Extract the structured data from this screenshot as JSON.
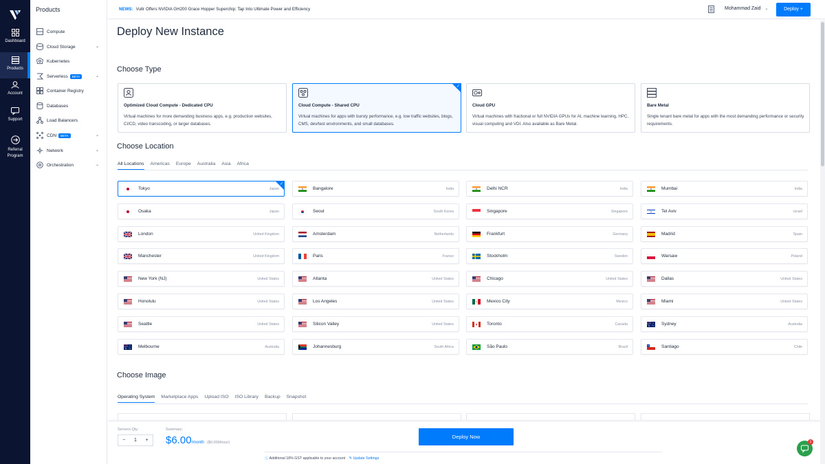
{
  "nav_rail": {
    "items": [
      {
        "label": "Dashboard",
        "icon": "grid-icon"
      },
      {
        "label": "Products",
        "icon": "stack-icon"
      },
      {
        "label": "Account",
        "icon": "user-icon"
      },
      {
        "label": "Support",
        "icon": "chat-icon"
      },
      {
        "label": "Referral Program",
        "icon": "referral-icon"
      }
    ]
  },
  "sidebar": {
    "title": "Products",
    "items": [
      {
        "label": "Compute",
        "icon": "server-icon"
      },
      {
        "label": "Cloud Storage",
        "icon": "storage-icon",
        "expandable": true
      },
      {
        "label": "Kubernetes",
        "icon": "kubernetes-icon"
      },
      {
        "label": "Serverless",
        "icon": "serverless-icon",
        "badge": "BETA",
        "expandable": true
      },
      {
        "label": "Container Registry",
        "icon": "registry-icon"
      },
      {
        "label": "Databases",
        "icon": "database-icon"
      },
      {
        "label": "Load Balancers",
        "icon": "load-balancer-icon"
      },
      {
        "label": "CDN",
        "icon": "cdn-icon",
        "badge": "BETA",
        "expandable": true
      },
      {
        "label": "Network",
        "icon": "network-icon",
        "expandable": true
      },
      {
        "label": "Orchestration",
        "icon": "orchestration-icon",
        "expandable": true
      }
    ]
  },
  "topbar": {
    "news_label": "NEWS:",
    "news_text": "Vultr Offers NVIDIA GH200 Grace Hopper Superchip: Tap Into Ultimate Power and Efficiency",
    "user_name": "Mohammad Zaid",
    "deploy_label": "Deploy +"
  },
  "page_title": "Deploy New Instance",
  "choose_type": {
    "heading": "Choose Type",
    "cards": [
      {
        "name": "Optimized Cloud Compute - Dedicated CPU",
        "desc": "Virtual machines for more demanding business apps, e.g. production websites, CI/CD, video transcoding, or larger databases.",
        "selected": false
      },
      {
        "name": "Cloud Compute - Shared CPU",
        "desc": "Virtual machines for apps with bursty performance, e.g. low traffic websites, blogs, CMS, dev/test environments, and small databases.",
        "selected": true
      },
      {
        "name": "Cloud GPU",
        "desc": "Virtual machines with fractional or full NVIDIA GPUs for AI, machine learning, HPC, visual computing and VDI. Also available as Bare Metal.",
        "selected": false
      },
      {
        "name": "Bare Metal",
        "desc": "Single tenant bare metal for apps with the most demanding performance or security requirements.",
        "selected": false
      }
    ]
  },
  "choose_location": {
    "heading": "Choose Location",
    "tabs": [
      "All Locations",
      "Americas",
      "Europe",
      "Australia",
      "Asia",
      "Africa"
    ],
    "active_tab": "All Locations",
    "locations": [
      {
        "city": "Tokyo",
        "country": "Japan",
        "flag": "jp",
        "selected": true
      },
      {
        "city": "Bangalore",
        "country": "India",
        "flag": "in"
      },
      {
        "city": "Delhi NCR",
        "country": "India",
        "flag": "in"
      },
      {
        "city": "Mumbai",
        "country": "India",
        "flag": "in"
      },
      {
        "city": "Osaka",
        "country": "Japan",
        "flag": "jp"
      },
      {
        "city": "Seoul",
        "country": "South Korea",
        "flag": "kr"
      },
      {
        "city": "Singapore",
        "country": "Singapore",
        "flag": "sg"
      },
      {
        "city": "Tel Aviv",
        "country": "Israel",
        "flag": "il"
      },
      {
        "city": "London",
        "country": "United Kingdom",
        "flag": "gb"
      },
      {
        "city": "Amsterdam",
        "country": "Netherlands",
        "flag": "nl"
      },
      {
        "city": "Frankfurt",
        "country": "Germany",
        "flag": "de"
      },
      {
        "city": "Madrid",
        "country": "Spain",
        "flag": "es"
      },
      {
        "city": "Manchester",
        "country": "United Kingdom",
        "flag": "gb"
      },
      {
        "city": "Paris",
        "country": "France",
        "flag": "fr"
      },
      {
        "city": "Stockholm",
        "country": "Sweden",
        "flag": "se"
      },
      {
        "city": "Warsaw",
        "country": "Poland",
        "flag": "pl"
      },
      {
        "city": "New York (NJ)",
        "country": "United States",
        "flag": "us"
      },
      {
        "city": "Atlanta",
        "country": "United States",
        "flag": "us"
      },
      {
        "city": "Chicago",
        "country": "United States",
        "flag": "us"
      },
      {
        "city": "Dallas",
        "country": "United States",
        "flag": "us"
      },
      {
        "city": "Honolulu",
        "country": "United States",
        "flag": "us"
      },
      {
        "city": "Los Angeles",
        "country": "United States",
        "flag": "us"
      },
      {
        "city": "Mexico City",
        "country": "Mexico",
        "flag": "mx"
      },
      {
        "city": "Miami",
        "country": "United States",
        "flag": "us"
      },
      {
        "city": "Seattle",
        "country": "United States",
        "flag": "us"
      },
      {
        "city": "Silicon Valley",
        "country": "United States",
        "flag": "us"
      },
      {
        "city": "Toronto",
        "country": "Canada",
        "flag": "ca"
      },
      {
        "city": "Sydney",
        "country": "Australia",
        "flag": "au"
      },
      {
        "city": "Melbourne",
        "country": "Australia",
        "flag": "au"
      },
      {
        "city": "Johannesburg",
        "country": "South Africa",
        "flag": "za"
      },
      {
        "city": "São Paulo",
        "country": "Brazil",
        "flag": "br"
      },
      {
        "city": "Santiago",
        "country": "Chile",
        "flag": "cl"
      }
    ]
  },
  "choose_image": {
    "heading": "Choose Image",
    "tabs": [
      "Operating System",
      "Marketplace Apps",
      "Upload ISO",
      "ISO Library",
      "Backup",
      "Snapshot"
    ],
    "active_tab": "Operating System"
  },
  "bottom_bar": {
    "qty_label": "Servers Qty:",
    "qty_minus": "−",
    "qty_value": "1",
    "qty_plus": "+",
    "summary_label": "Summary:",
    "price": "$6.00",
    "price_period": "/month",
    "price_hourly": "($0.009/hour)",
    "deploy_now": "Deploy Now",
    "gst_note": "Additional 18% GST applicable to your account",
    "update_settings": "Update Settings"
  },
  "chat_badge": "1",
  "colors": {
    "accent": "#007bfc",
    "rail": "#0b1430"
  }
}
